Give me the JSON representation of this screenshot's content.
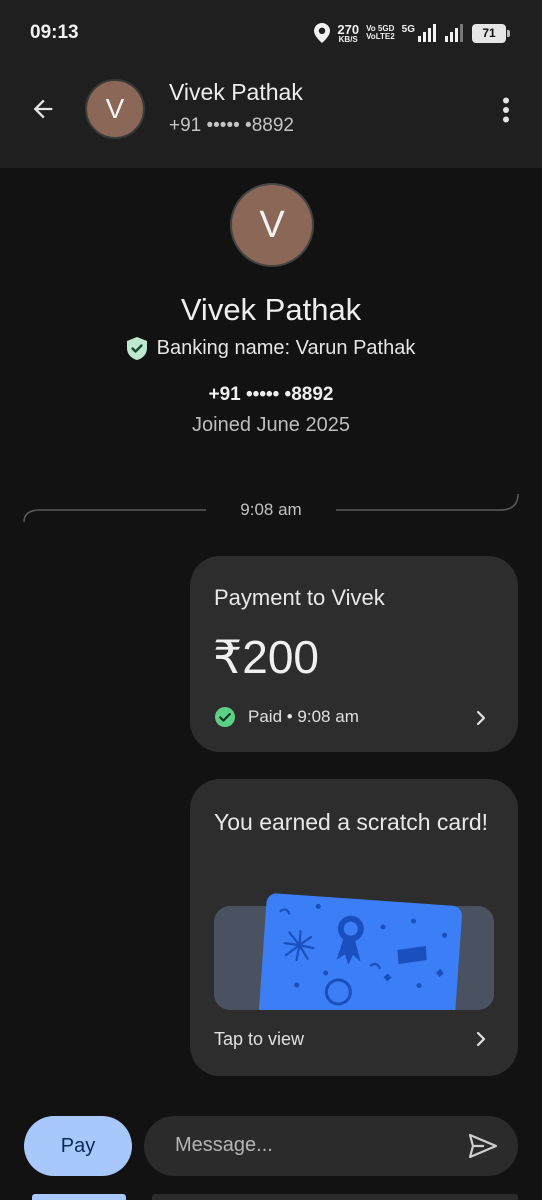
{
  "status_bar": {
    "time": "09:13",
    "net_speed_value": "270",
    "net_speed_unit": "KB/S",
    "volte_top": "Vo 5GD",
    "volte_bottom": "VoLTE2",
    "network_label": "5G",
    "battery": "71"
  },
  "header": {
    "avatar_initial": "V",
    "name": "Vivek Pathak",
    "phone": "+91 ••••• •8892"
  },
  "profile": {
    "avatar_initial": "V",
    "name": "Vivek Pathak",
    "banking_name": "Banking name: Varun Pathak",
    "phone": "+91 ••••• •8892",
    "joined": "Joined June 2025"
  },
  "chat": {
    "divider_time": "9:08 am",
    "payment": {
      "title": "Payment to Vivek",
      "amount": "₹200",
      "status": "Paid • 9:08 am",
      "status_color": "#5bd186"
    },
    "scratch": {
      "title": "You earned a scratch card!",
      "action": "Tap to view",
      "card_color": "#3b7ef5"
    }
  },
  "composer": {
    "pay_label": "Pay",
    "message_placeholder": "Message..."
  },
  "colors": {
    "background": "#121212",
    "header": "#1f1f1f",
    "bubble": "#2d2d2d",
    "accent": "#a8c7fa",
    "avatar": "#8a6757",
    "verified": "#bfe9cf"
  },
  "icons": {
    "back": "arrow-left-icon",
    "more": "more-vert-icon",
    "verified": "shield-check-icon",
    "paid": "check-circle-icon",
    "chevron": "chevron-right-icon",
    "send": "send-icon"
  }
}
